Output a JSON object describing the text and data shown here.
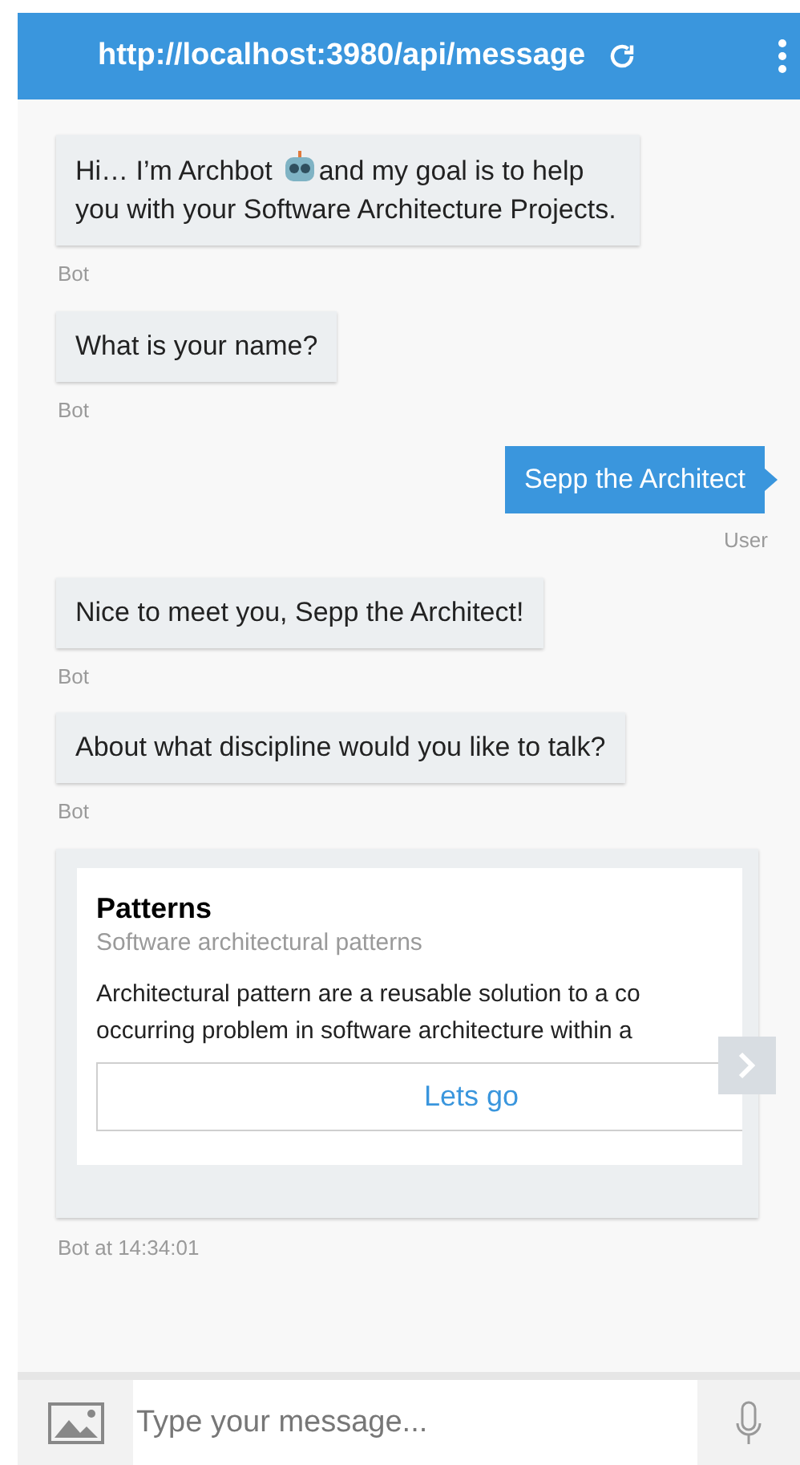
{
  "header": {
    "title": "http://localhost:3980/api/message"
  },
  "messages": [
    {
      "kind": "bot",
      "text_before": "Hi… I’m Archbot",
      "text_after": "and my goal is to help",
      "text_rest": "you with your Software Architecture Projects.",
      "caption": "Bot"
    },
    {
      "kind": "bot",
      "text": "What is your name?",
      "caption": "Bot"
    },
    {
      "kind": "user",
      "text": "Sepp the Architect",
      "caption": "User"
    },
    {
      "kind": "bot",
      "text": "Nice to meet you, Sepp the Architect!",
      "caption": "Bot"
    },
    {
      "kind": "bot",
      "text": "About what discipline would you like to talk?",
      "caption": "Bot"
    },
    {
      "kind": "card",
      "title": "Patterns",
      "subtitle": "Software architectural patterns",
      "lines": [
        "Architectural pattern are a reusable solution to a co",
        "occurring problem in software architecture within a"
      ],
      "button": "Lets go",
      "caption": "Bot at 14:34:01"
    }
  ],
  "composer": {
    "placeholder": "Type your message..."
  }
}
